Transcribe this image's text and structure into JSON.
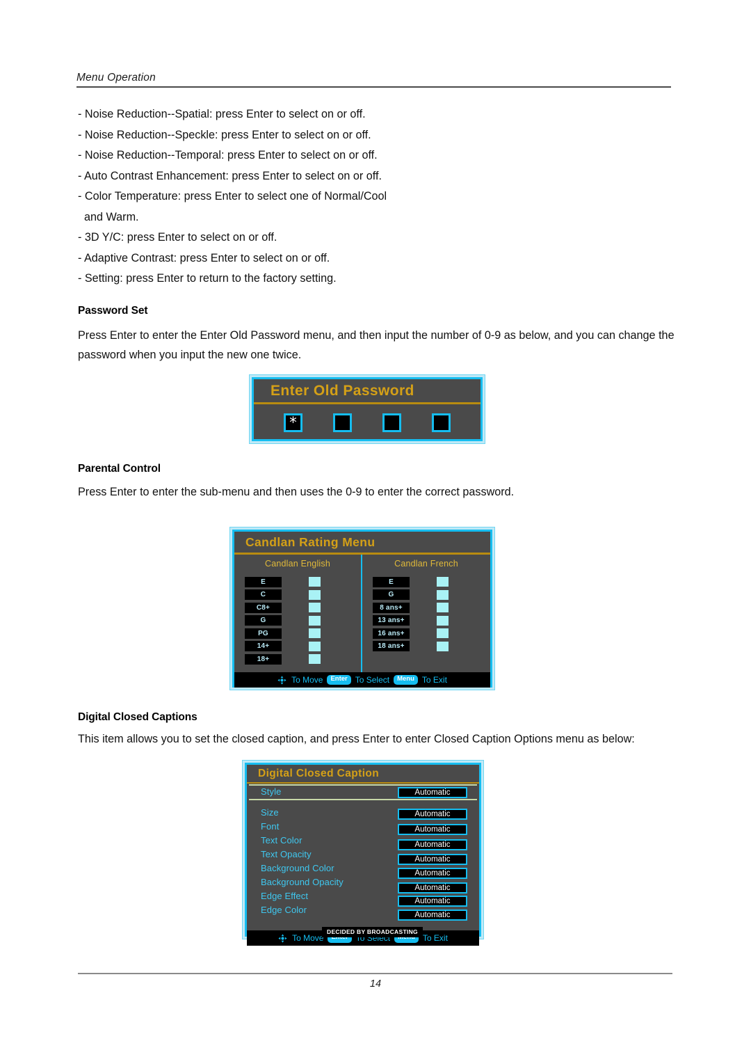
{
  "header": {
    "title": "Menu Operation"
  },
  "bullets": [
    "- Noise Reduction--Spatial: press Enter to select on or off.",
    "- Noise Reduction--Speckle: press Enter to select on or off.",
    "- Noise Reduction--Temporal: press Enter to select on or off.",
    "- Auto Contrast Enhancement: press Enter to select on or off.",
    "- Color Temperature: press Enter to select one of Normal/Cool",
    "and Warm.",
    "- 3D Y/C: press Enter to select on or off.",
    "- Adaptive Contrast: press Enter to select on or off.",
    "- Setting: press Enter to return to the factory setting."
  ],
  "sections": {
    "password": {
      "heading": "Password Set",
      "paragraph": "Press Enter to enter the Enter Old Password menu, and then input the number of 0-9 as below, and you can change the password when you input the new one twice."
    },
    "parental": {
      "heading": "Parental Control",
      "paragraph": "Press Enter to enter the sub-menu and then uses the 0-9 to enter the correct password."
    },
    "captions": {
      "heading": "Digital Closed Captions",
      "paragraph": "This item allows you to set the closed caption, and press Enter to enter Closed Caption Options menu as below:"
    }
  },
  "osd_password": {
    "title": "Enter Old Password",
    "digits": [
      "*",
      "",
      "",
      ""
    ]
  },
  "osd_rating": {
    "title": "Candlan Rating Menu",
    "columns": [
      {
        "title": "Candlan English",
        "ratings": [
          "E",
          "C",
          "C8+",
          "G",
          "PG",
          "14+",
          "18+"
        ]
      },
      {
        "title": "Candlan French",
        "ratings": [
          "E",
          "G",
          "8 ans+",
          "13 ans+",
          "16 ans+",
          "18 ans+"
        ]
      }
    ],
    "footer": {
      "move_label": "To Move",
      "enter_key": "Enter",
      "select_label": "To Select",
      "menu_key": "Menu",
      "exit_label": "To Exit"
    }
  },
  "osd_caption": {
    "title": "Digital Closed Caption",
    "rows": [
      {
        "label": "Style",
        "value": "Automatic",
        "highlighted": true
      },
      {
        "label": "Size",
        "value": "Automatic",
        "highlighted": false
      },
      {
        "label": "Font",
        "value": "Automatic",
        "highlighted": false
      },
      {
        "label": "Text Color",
        "value": "Automatic",
        "highlighted": false
      },
      {
        "label": "Text Opacity",
        "value": "Automatic",
        "highlighted": false
      },
      {
        "label": "Background Color",
        "value": "Automatic",
        "highlighted": false
      },
      {
        "label": "Background Opacity",
        "value": "Automatic",
        "highlighted": false
      },
      {
        "label": "Edge Effect",
        "value": "Automatic",
        "highlighted": false
      },
      {
        "label": "Edge Color",
        "value": "Automatic",
        "highlighted": false
      }
    ],
    "note": "DECIDED BY BROADCASTING",
    "footer": {
      "move_label": "To Move",
      "enter_key": "Enter",
      "select_label": "To Select",
      "menu_key": "Menu",
      "exit_label": "To Exit"
    }
  },
  "footer": {
    "page_number": "14"
  },
  "colors": {
    "osd_border": "#15bdf0",
    "osd_background": "#4a4a4a",
    "osd_title": "#d4a017",
    "osd_label": "#3fc8f0",
    "osd_highlight_label": "#8e7c33",
    "checkbox": "#a9f2f5"
  }
}
